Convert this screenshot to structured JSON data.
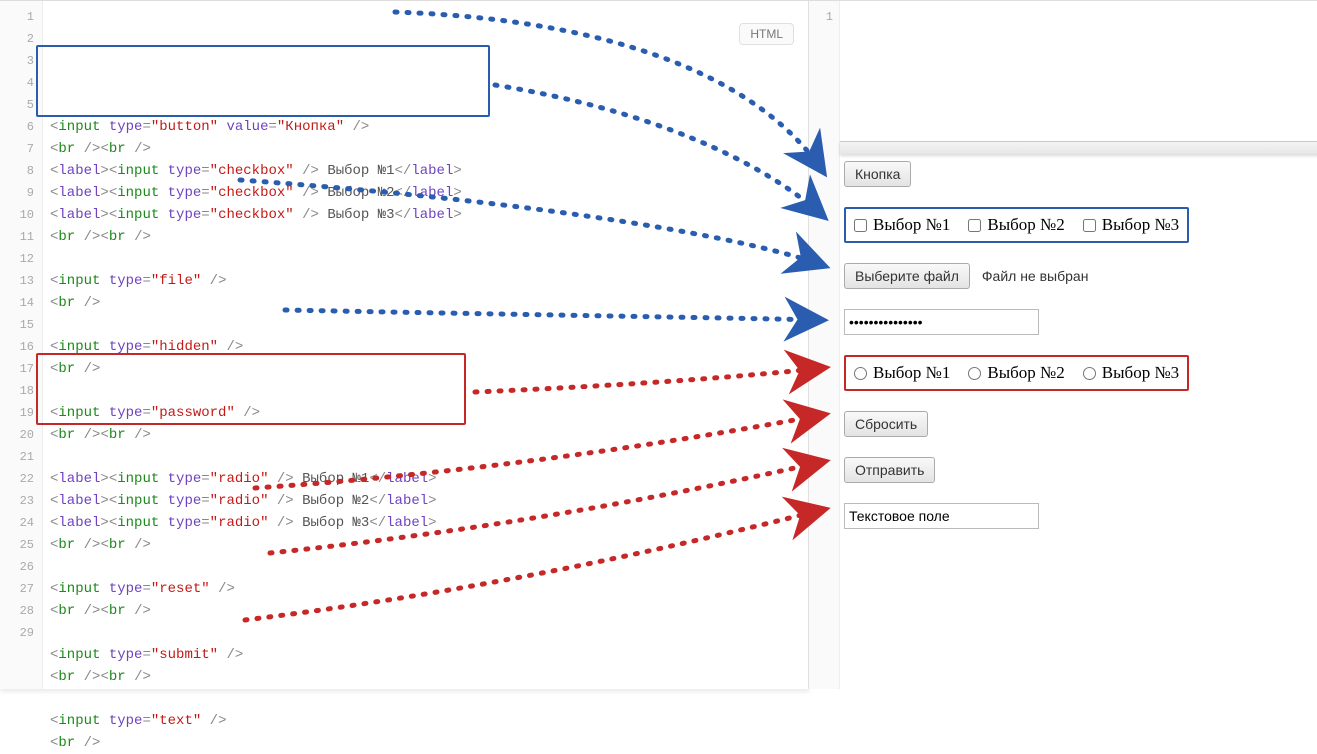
{
  "badge": "HTML",
  "gutter": [
    "1",
    "2",
    "3",
    "4",
    "5",
    "6",
    "7",
    "8",
    "9",
    "10",
    "11",
    "12",
    "13",
    "14",
    "15",
    "16",
    "17",
    "18",
    "19",
    "20",
    "21",
    "22",
    "23",
    "24",
    "25",
    "26",
    "27",
    "28",
    "29"
  ],
  "right_gutter": [
    "1"
  ],
  "code": {
    "button_value": "Кнопка",
    "checkbox_text": [
      "Выбор №1",
      "Выбор №2",
      "Выбор №3"
    ],
    "radio_text": [
      "Выбор №1",
      "Выбор №2",
      "Выбор №3"
    ],
    "types": {
      "button": "button",
      "checkbox": "checkbox",
      "file": "file",
      "hidden": "hidden",
      "password": "password",
      "radio": "radio",
      "reset": "reset",
      "submit": "submit",
      "text": "text"
    }
  },
  "preview": {
    "button_label": "Кнопка",
    "checkbox_labels": [
      "Выбор №1",
      "Выбор №2",
      "Выбор №3"
    ],
    "file_button": "Выберите файл",
    "file_status": "Файл не выбран",
    "password_value": "•••••••••••••••",
    "radio_labels": [
      "Выбор №1",
      "Выбор №2",
      "Выбор №3"
    ],
    "reset_label": "Сбросить",
    "submit_label": "Отправить",
    "text_value": "Текстовое поле"
  },
  "colors": {
    "blue": "#2a5db0",
    "red": "#c62828",
    "green": "#1b8a1b",
    "purple": "#6f42c1",
    "string": "#c41a16"
  }
}
